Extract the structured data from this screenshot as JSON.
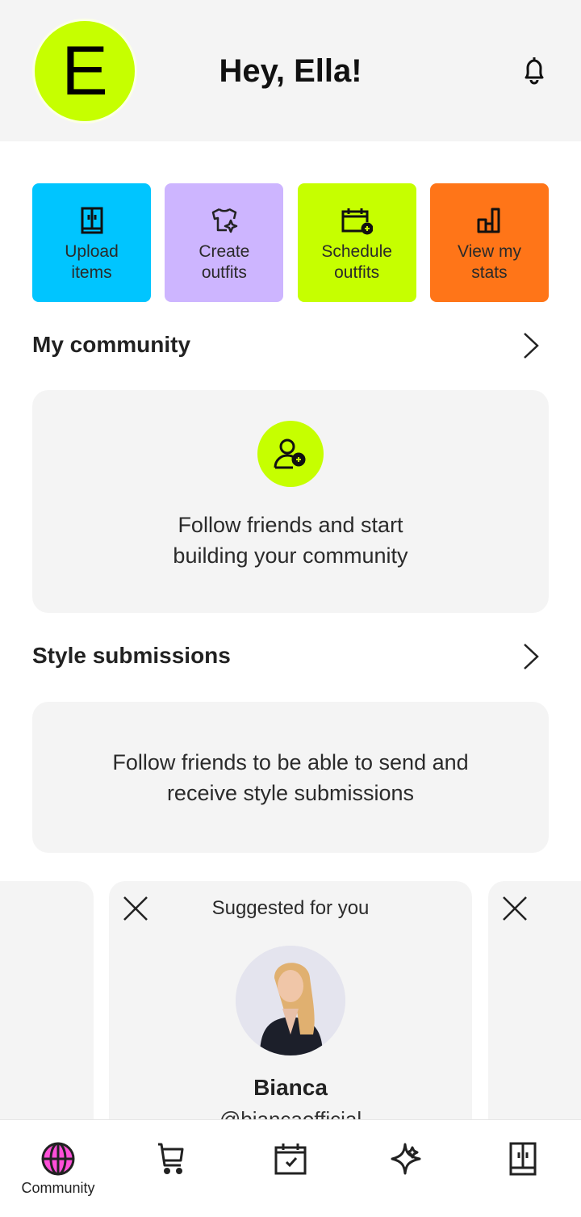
{
  "header": {
    "avatar_initial": "E",
    "greeting": "Hey, Ella!",
    "notifications_icon": "bell-icon"
  },
  "quick_actions": [
    {
      "label": "Upload\nitems",
      "icon": "wardrobe-icon",
      "color": "#00c5ff"
    },
    {
      "label": "Create\noutfits",
      "icon": "shirt-sparkle-icon",
      "color": "#cdb5ff"
    },
    {
      "label": "Schedule\noutfits",
      "icon": "calendar-plus-icon",
      "color": "#c6ff00"
    },
    {
      "label": "View my\nstats",
      "icon": "bar-chart-icon",
      "color": "#ff7518"
    }
  ],
  "community": {
    "title": "My community",
    "empty_message": "Follow friends and start\nbuilding your community",
    "icon": "add-user-icon"
  },
  "style_submissions": {
    "title": "Style submissions",
    "empty_message": "Follow friends to be able to send and\nreceive style submissions"
  },
  "suggested": {
    "title": "Suggested for you",
    "name": "Bianca",
    "handle": "@biancaofficial"
  },
  "tabbar": {
    "items": [
      {
        "label": "Community",
        "icon": "globe-icon",
        "active": true
      },
      {
        "label": "",
        "icon": "cart-icon"
      },
      {
        "label": "",
        "icon": "calendar-check-icon"
      },
      {
        "label": "",
        "icon": "sparkle-icon"
      },
      {
        "label": "",
        "icon": "wardrobe-icon"
      }
    ]
  },
  "colors": {
    "accent_lime": "#c6ff00",
    "accent_pink": "#ff4fd8",
    "card_bg": "#f4f4f4"
  }
}
